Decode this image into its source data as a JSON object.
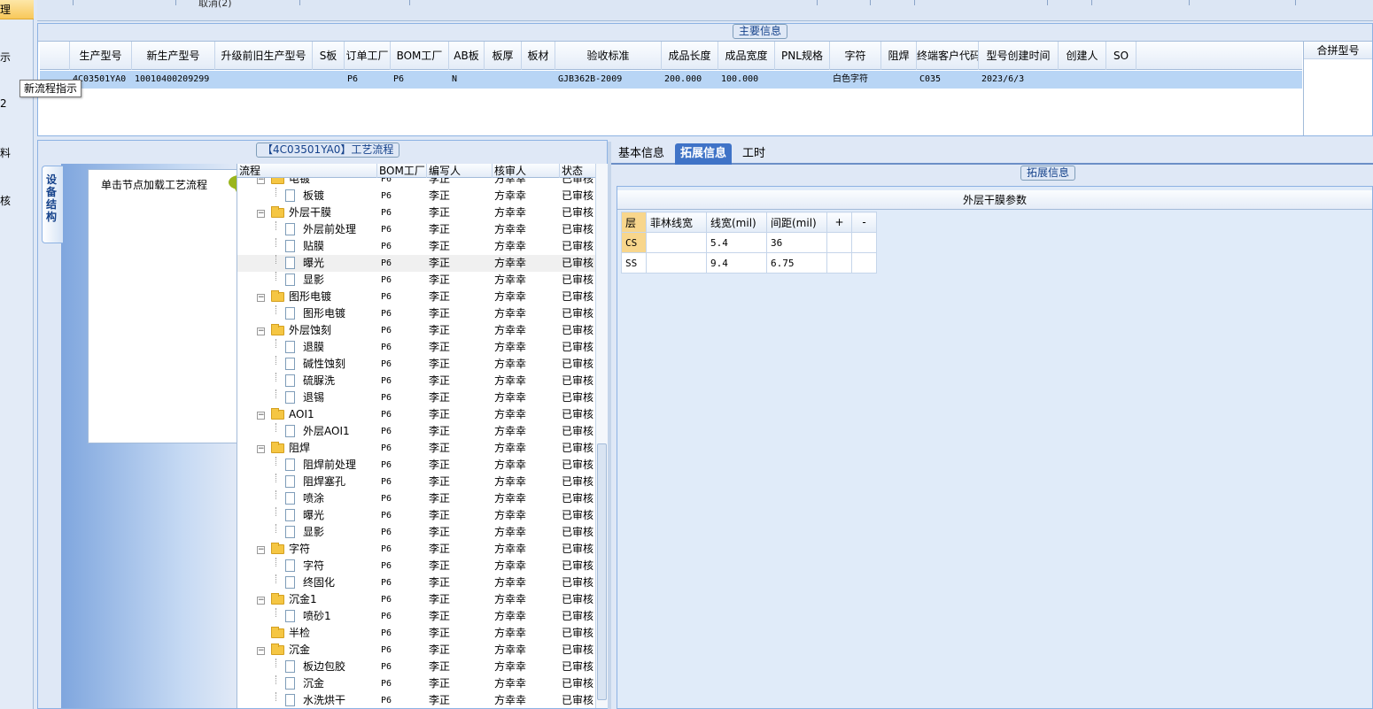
{
  "left_nav": {
    "items": [
      "理",
      "示",
      "2",
      "料",
      "核"
    ]
  },
  "top": {
    "cancel_text": "取消(2)"
  },
  "main_info": {
    "title": "主要信息",
    "columns": [
      "生产型号",
      "新生产型号",
      "升级前旧生产型号",
      "S板",
      "订单工厂",
      "BOM工厂",
      "AB板",
      "板厚",
      "板材",
      "验收标准",
      "成品长度",
      "成品宽度",
      "PNL规格",
      "字符",
      "阻焊",
      "终端客户代码",
      "型号创建时间",
      "创建人",
      "SO"
    ],
    "row": [
      "4C03501YA0",
      "10010400209299",
      "",
      "",
      "P6",
      "P6",
      "N",
      "",
      "",
      "GJB362B-2009",
      "200.000",
      "100.000",
      "",
      "白色字符",
      "",
      "C035",
      "2023/6/3",
      "",
      ""
    ],
    "merged_header": "合拼型号",
    "tooltip": "新流程指示"
  },
  "flow": {
    "title": "【4C03501YA0】工艺流程",
    "side_tab": "设备结构",
    "hint": "单击节点加载工艺流程",
    "columns": [
      "流程",
      "BOM工厂",
      "编写人",
      "核审人",
      "状态"
    ],
    "rows": [
      {
        "name": "电镀",
        "level": 0,
        "folder": true
      },
      {
        "name": "板镀",
        "level": 1,
        "folder": false
      },
      {
        "name": "外层干膜",
        "level": 0,
        "folder": true
      },
      {
        "name": "外层前处理",
        "level": 1,
        "folder": false
      },
      {
        "name": "贴膜",
        "level": 1,
        "folder": false
      },
      {
        "name": "曝光",
        "level": 1,
        "folder": false,
        "selected": true
      },
      {
        "name": "显影",
        "level": 1,
        "folder": false
      },
      {
        "name": "图形电镀",
        "level": 0,
        "folder": true
      },
      {
        "name": "图形电镀",
        "level": 1,
        "folder": false
      },
      {
        "name": "外层蚀刻",
        "level": 0,
        "folder": true
      },
      {
        "name": "退膜",
        "level": 1,
        "folder": false
      },
      {
        "name": "碱性蚀刻",
        "level": 1,
        "folder": false
      },
      {
        "name": "硫脲洗",
        "level": 1,
        "folder": false
      },
      {
        "name": "退锡",
        "level": 1,
        "folder": false
      },
      {
        "name": "AOI1",
        "level": 0,
        "folder": true
      },
      {
        "name": "外层AOI1",
        "level": 1,
        "folder": false
      },
      {
        "name": "阻焊",
        "level": 0,
        "folder": true
      },
      {
        "name": "阻焊前处理",
        "level": 1,
        "folder": false
      },
      {
        "name": "阻焊塞孔",
        "level": 1,
        "folder": false
      },
      {
        "name": "喷涂",
        "level": 1,
        "folder": false
      },
      {
        "name": "曝光",
        "level": 1,
        "folder": false
      },
      {
        "name": "显影",
        "level": 1,
        "folder": false
      },
      {
        "name": "字符",
        "level": 0,
        "folder": true
      },
      {
        "name": "字符",
        "level": 1,
        "folder": false
      },
      {
        "name": "终固化",
        "level": 1,
        "folder": false
      },
      {
        "name": "沉金1",
        "level": 0,
        "folder": true
      },
      {
        "name": "喷砂1",
        "level": 1,
        "folder": false
      },
      {
        "name": "半检",
        "level": 0,
        "folder": true,
        "leafless": true
      },
      {
        "name": "沉金",
        "level": 0,
        "folder": true
      },
      {
        "name": "板边包胶",
        "level": 1,
        "folder": false
      },
      {
        "name": "沉金",
        "level": 1,
        "folder": false
      },
      {
        "name": "水洗烘干",
        "level": 1,
        "folder": false
      }
    ],
    "row_values": {
      "bom": "P6",
      "writer": "李正",
      "reviewer": "方幸幸",
      "status": "已审核"
    }
  },
  "right": {
    "tabs": [
      "基本信息",
      "拓展信息",
      "工时"
    ],
    "active_tab": 1,
    "ext_title": "拓展信息",
    "param_title": "外层干膜参数",
    "param_columns": [
      "层",
      "菲林线宽",
      "线宽(mil)",
      "间距(mil)",
      "+",
      "-"
    ],
    "param_rows": [
      [
        "CS",
        "",
        "5.4",
        "36",
        "",
        ""
      ],
      [
        "SS",
        "",
        "9.4",
        "6.75",
        "",
        ""
      ]
    ]
  },
  "colors": {
    "selection": "#b8d5f5",
    "tab_active": "#3f73c7",
    "accent": "#15428b"
  }
}
